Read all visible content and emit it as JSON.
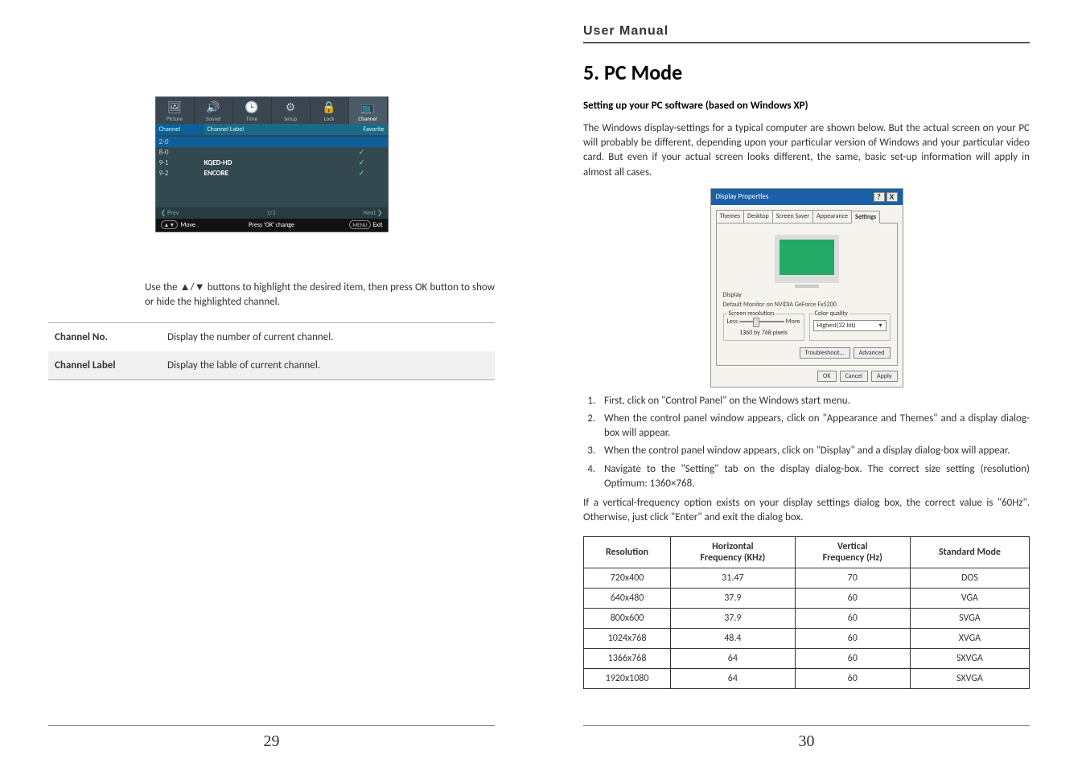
{
  "left": {
    "page_number": "29",
    "osd": {
      "tabs": [
        "Picture",
        "Sound",
        "Time",
        "Setup",
        "Lock",
        "Channel"
      ],
      "selected_tab": "Channel",
      "header": {
        "c1": "Channel",
        "c2": "Channel Label",
        "c3": "Favorite"
      },
      "rows": [
        {
          "ch": "2-0",
          "label": "",
          "fav": ""
        },
        {
          "ch": "8-0",
          "label": "",
          "fav": "✓"
        },
        {
          "ch": "9-1",
          "label": "KQED-HD",
          "fav": "✓"
        },
        {
          "ch": "9-2",
          "label": "ENCORE",
          "fav": "✓"
        }
      ],
      "nav": {
        "prev": "❮ Prev",
        "page": "1/1",
        "next": "Next ❯"
      },
      "footer": {
        "move": "Move",
        "ok": "Press 'OK' change",
        "menu_badge": "MENU",
        "exit": "Exit"
      }
    },
    "instruction": "Use the ▲/▼ buttons to highlight the desired item, then press OK button to show or hide the highlighted channel.",
    "defs": [
      {
        "k": "Channel No.",
        "v": "Display the number of current channel."
      },
      {
        "k": "Channel Label",
        "v": "Display the lable of current channel."
      }
    ]
  },
  "right": {
    "page_number": "30",
    "section": "User Manual",
    "title": "5. PC Mode",
    "subtitle": "Setting up your PC software (based on Windows XP)",
    "intro": "The Windows display-settings for a typical computer are shown below. But the actual screen on your PC will probably be different, depending upon your particular version of Windows and your particular video card. But even if your actual screen looks different, the same, basic set-up information will apply in almost all cases.",
    "dp": {
      "title": "Display Properties",
      "tabs": [
        "Themes",
        "Desktop",
        "Screen Saver",
        "Appearance",
        "Settings"
      ],
      "selected_tab": "Settings",
      "display_label": "Display",
      "display_value": "Default Monitor on NVIDIA GeForce Fx5200",
      "sr_legend": "Screen resolution",
      "sr_less": "Less",
      "sr_more": "More",
      "sr_value": "1360 by 768 pixels",
      "cq_legend": "Color quality",
      "cq_value": "Highest(32 bit)",
      "troubleshoot": "Troubleshoot...",
      "advanced": "Advanced",
      "ok": "OK",
      "cancel": "Cancel",
      "apply": "Apply"
    },
    "steps": [
      "First, click on \"Control Panel\" on the Windows start menu.",
      "When the control panel window appears, click on \"Appearance and Themes\" and a display dialog-box will appear.",
      "When the control panel window appears, click on \"Display\" and a display dialog-box will appear.",
      "Navigate to the \"Setting\" tab on the display dialog-box. The correct size setting (resolution) Optimum: 1360×768."
    ],
    "post_steps": "If a vertical-frequency option exists on your display settings dialog box, the correct value is \"60Hz\". Otherwise, just click \"Enter\" and exit the dialog box.",
    "res_table": {
      "headers": {
        "res": "Resolution",
        "h": "Horizontal",
        "h2": "Frequency (KHz)",
        "v": "Vertical",
        "v2": "Frequency (Hz)",
        "m": "Standard Mode"
      },
      "rows": [
        {
          "r": "720x400",
          "h": "31.47",
          "v": "70",
          "m": "DOS"
        },
        {
          "r": "640x480",
          "h": "37.9",
          "v": "60",
          "m": "VGA"
        },
        {
          "r": "800x600",
          "h": "37.9",
          "v": "60",
          "m": "SVGA"
        },
        {
          "r": "1024x768",
          "h": "48.4",
          "v": "60",
          "m": "XVGA"
        },
        {
          "r": "1366x768",
          "h": "64",
          "v": "60",
          "m": "SXVGA"
        },
        {
          "r": "1920x1080",
          "h": "64",
          "v": "60",
          "m": "SXVGA"
        }
      ]
    }
  }
}
